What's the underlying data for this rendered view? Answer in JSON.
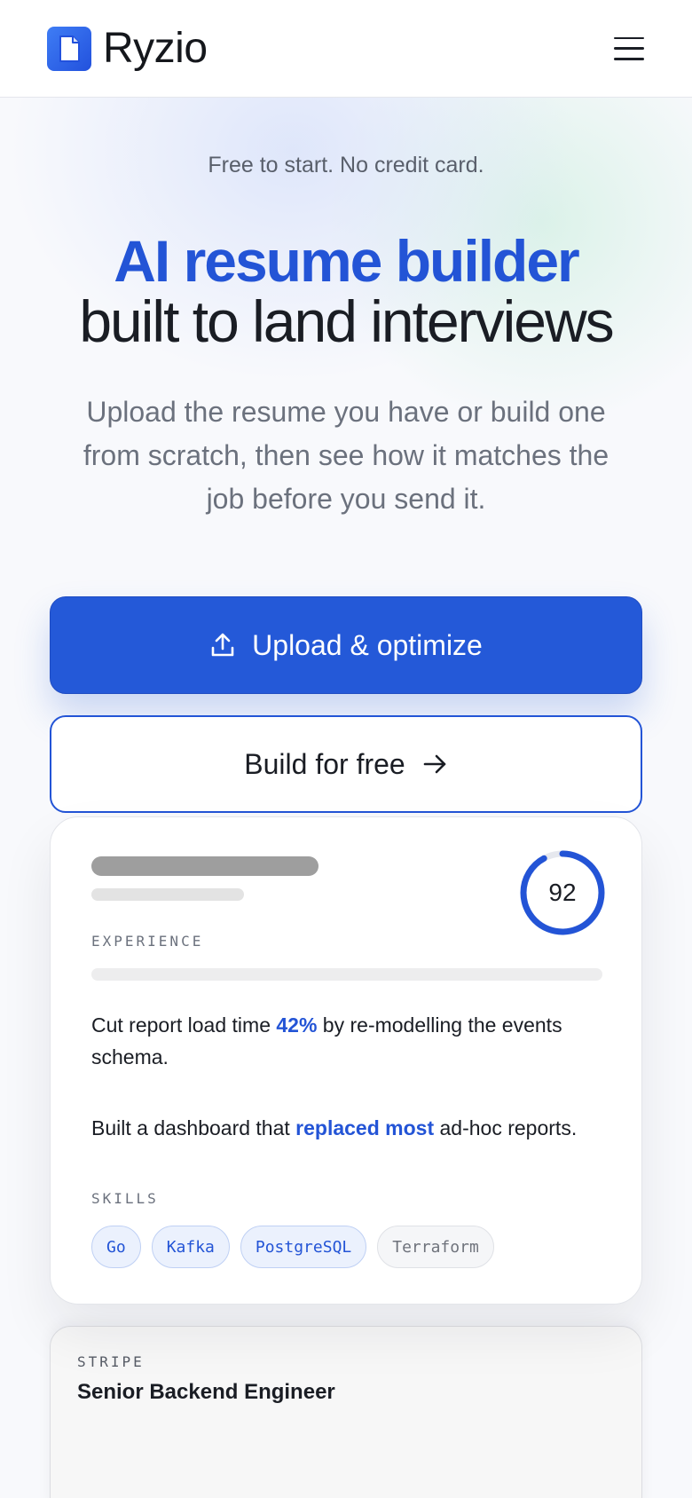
{
  "header": {
    "brand": "Ryzio",
    "logo_icon": "document-icon",
    "menu_icon": "hamburger-menu-icon"
  },
  "hero": {
    "eyebrow": "Free to start. No credit card.",
    "title_accent": "AI resume builder",
    "title_rest": "built to land interviews",
    "subtitle": "Upload the resume you have or build one from scratch, then see how it matches the job before you send it.",
    "primary_button": {
      "label": "Upload & optimize",
      "icon": "upload-icon"
    },
    "secondary_button": {
      "label": "Build for free",
      "icon": "arrow-right-icon"
    }
  },
  "preview_card": {
    "score": "92",
    "score_fraction": 0.92,
    "experience_label": "EXPERIENCE",
    "bullet_1": {
      "before": "Cut report load time ",
      "highlight": "42%",
      "after": " by re-modelling the events schema."
    },
    "bullet_2": {
      "before": "Built a dashboard that ",
      "highlight": "replaced most",
      "after": " ad-hoc reports."
    },
    "skills_label": "SKILLS",
    "skills": [
      "Go",
      "Kafka",
      "PostgreSQL",
      "Terraform"
    ]
  },
  "job_card": {
    "company": "STRIPE",
    "role": "Senior Backend Engineer"
  },
  "colors": {
    "accent": "#2459d8",
    "text": "#1a1d24",
    "muted": "#6b717d"
  }
}
